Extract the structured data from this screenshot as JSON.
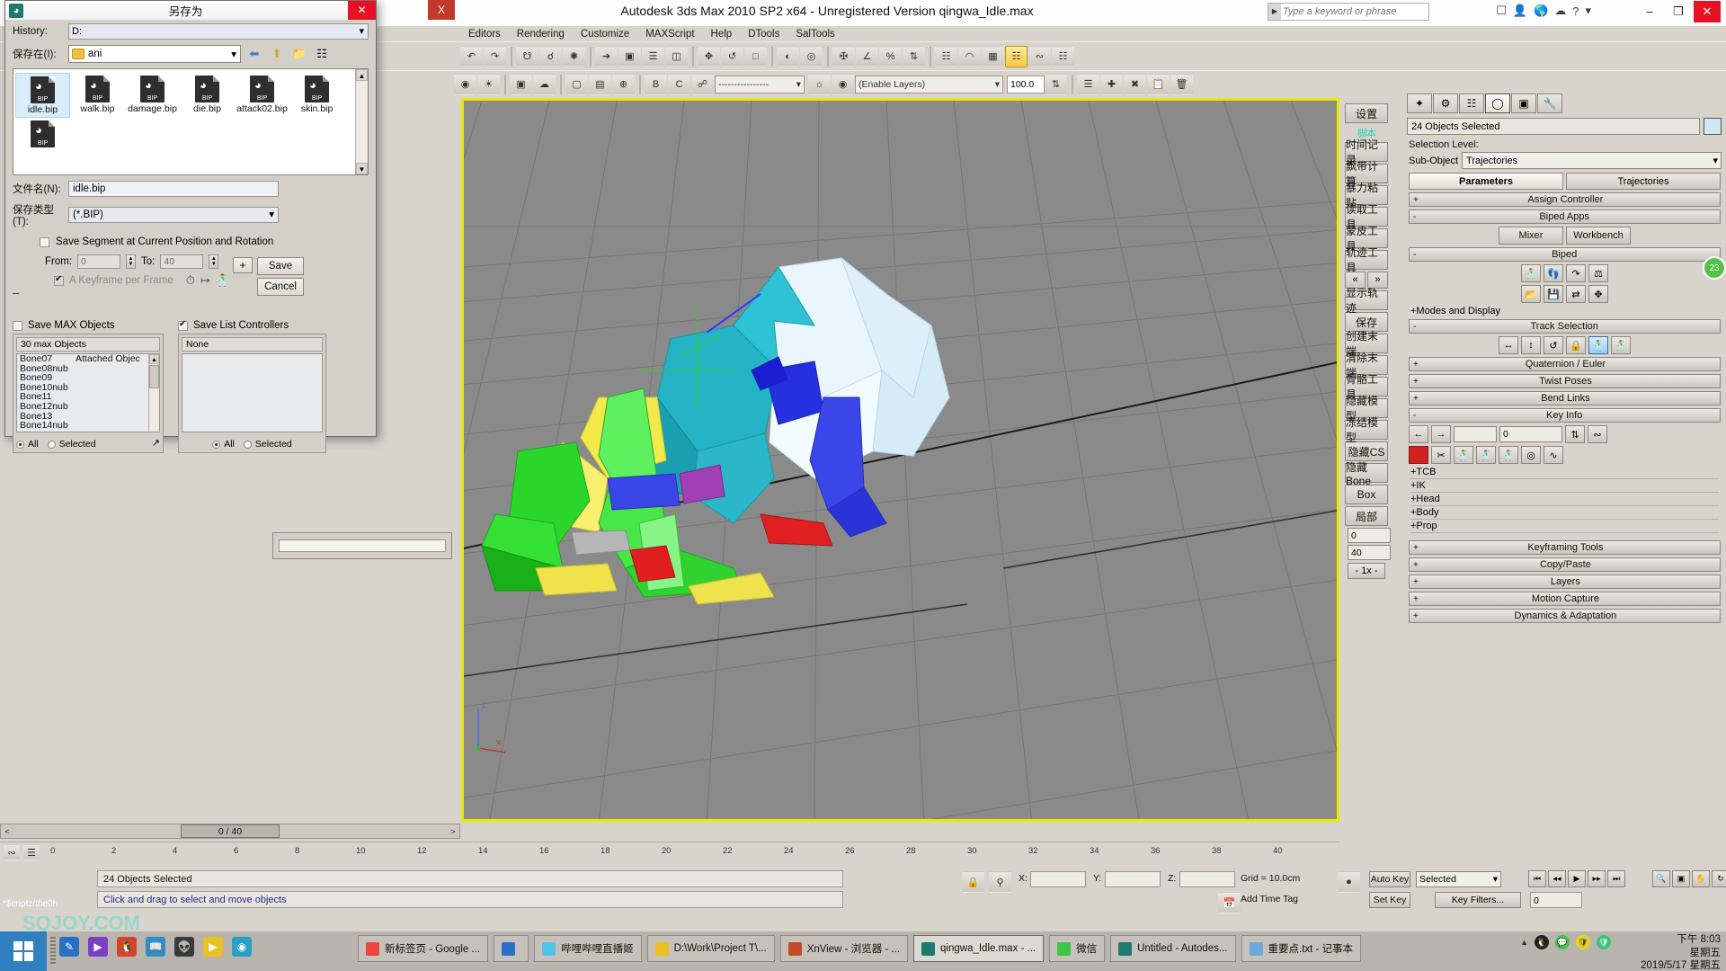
{
  "app": {
    "title": "Autodesk 3ds Max  2010 SP2 x64  - Unregistered Version     qingwa_Idle.max",
    "icon": "max-logo-icon",
    "search_placeholder": "Type a keyword or phrase",
    "min_label": "–",
    "max_label": "❐",
    "close_label": "✕",
    "x_badge": "X"
  },
  "menu": {
    "items": [
      "Editors",
      "Rendering",
      "Customize",
      "MAXScript",
      "Help",
      "DTools",
      "SalTools"
    ]
  },
  "toolbar2": {
    "layer_combo": "(Enable Layers)",
    "percent": "100.0"
  },
  "viewport": {
    "label": "",
    "axis_x": "X",
    "axis_y": "Y",
    "axis_z": "Z"
  },
  "trackbar": {
    "prev": "<",
    "frame": "0 / 40",
    "next": ">",
    "ruler_ticks": [
      "0",
      "2",
      "4",
      "6",
      "8",
      "10",
      "12",
      "14",
      "16",
      "18",
      "20",
      "22",
      "24",
      "26",
      "28",
      "30",
      "32",
      "34",
      "36",
      "38",
      "40"
    ]
  },
  "status": {
    "selection": "24 Objects Selected",
    "hint": "Click and drag to select and move objects",
    "x_label": "X:",
    "x_value": "",
    "y_label": "Y:",
    "y_value": "",
    "z_label": "Z:",
    "z_value": "",
    "grid": "Grid = 10.0cm",
    "add_time_tag": "Add Time Tag",
    "auto_key": "Auto Key",
    "set_key": "Set Key",
    "anim_combo": "Selected",
    "key_filters": "Key Filters...",
    "key_value": "0"
  },
  "zh_toolbar": {
    "settings": "设置",
    "title": "脚本",
    "buttons": [
      "时间记录",
      "飘带计算",
      "暴力粘贴",
      "读取工具",
      "蒙皮工具",
      "轨迹工具"
    ],
    "prev": "«",
    "next": "»",
    "buttons2": [
      "显示轨迹",
      "保存",
      "创建末端",
      "清除末端",
      "骨骼工具",
      "隐藏模型",
      "冻结模型",
      "隐藏CS",
      "隐藏Bone"
    ],
    "box": "Box",
    "local": "局部",
    "from": "0",
    "to": "40",
    "x1": "- 1x -"
  },
  "command_panel": {
    "tabs": [
      "create-icon",
      "modify-icon",
      "hierarchy-icon",
      "motion-icon",
      "display-icon",
      "utilities-icon"
    ],
    "object_name": "24 Objects Selected",
    "selection_level_label": "Selection Level:",
    "sub_object_label": "Sub-Object",
    "sub_object_value": "Trajectories",
    "tab_parameters": "Parameters",
    "tab_trajectories": "Trajectories",
    "rollouts": [
      {
        "sign": "+",
        "text": "Assign Controller"
      },
      {
        "sign": "-",
        "text": "Biped Apps"
      },
      {
        "sign": "-",
        "text": "Biped"
      },
      {
        "sign": "-",
        "text": "Track Selection"
      },
      {
        "sign": "+",
        "text": "Quaternion / Euler"
      },
      {
        "sign": "+",
        "text": "Twist Poses"
      },
      {
        "sign": "+",
        "text": "Bend Links"
      },
      {
        "sign": "-",
        "text": "Key Info"
      },
      {
        "sign": "+",
        "text": "Keyframing Tools"
      },
      {
        "sign": "+",
        "text": "Copy/Paste"
      },
      {
        "sign": "+",
        "text": "Layers"
      },
      {
        "sign": "+",
        "text": "Motion Capture"
      },
      {
        "sign": "+",
        "text": "Dynamics & Adaptation"
      }
    ],
    "biped_apps": {
      "mixer": "Mixer",
      "workbench": "Workbench"
    },
    "modes_and_display": "+Modes and Display",
    "key_info_subs": [
      "+TCB",
      "+IK",
      "+Head",
      "+Body",
      "+Prop"
    ],
    "key_info_value": "0",
    "range_from": "0",
    "range_to": "40"
  },
  "dialog": {
    "title": "另存为",
    "close": "✕",
    "history_label": "History:",
    "history_value": "D:",
    "lookin_label": "保存在(I):",
    "lookin_value": "ani",
    "nav_icons": [
      "back-icon",
      "up-folder-icon",
      "new-folder-icon",
      "view-mode-icon"
    ],
    "files": [
      {
        "name": "idle.bip",
        "tag": "BIP",
        "selected": true
      },
      {
        "name": "walk.bip",
        "tag": "BIP",
        "selected": false
      },
      {
        "name": "damage.bip",
        "tag": "BIP",
        "selected": false
      },
      {
        "name": "die.bip",
        "tag": "BIP",
        "selected": false
      },
      {
        "name": "attack02.bip",
        "tag": "BIP",
        "selected": false
      },
      {
        "name": "skin.bip",
        "tag": "BIP",
        "selected": false
      },
      {
        "name": "",
        "tag": "BIP",
        "selected": false
      }
    ],
    "filename_label": "文件名(N):",
    "filename_value": "idle.bip",
    "filetype_label": "保存类型(T):",
    "filetype_value": "(*.BIP)",
    "save_segment_label": "Save Segment at Current Position and Rotation",
    "save_segment_checked": false,
    "from_label": "From:",
    "from_value": "0",
    "to_label": "To:",
    "to_value": "40",
    "keyframe_label": "A Keyframe per Frame",
    "keyframe_checked": true,
    "plus_button": "+",
    "save_button": "Save",
    "cancel_button": "Cancel",
    "save_max_objects_label": "Save MAX Objects",
    "save_max_objects_checked": false,
    "save_list_controllers_label": "Save List Controllers",
    "save_list_controllers_checked": true,
    "left_list_header": "30 max Objects",
    "left_list_col2": "Attached Objec",
    "left_list_items": [
      "Bone07",
      "Bone08nub",
      "Bone09",
      "Bone10nub",
      "Bone11",
      "Bone12nub",
      "Bone13",
      "Bone14nub"
    ],
    "right_list_header": "None",
    "right_list_items": [],
    "radio_all": "All",
    "radio_selected": "Selected",
    "left_radio_selected": "All",
    "right_radio_selected": "All"
  },
  "taskbar": {
    "start": "start-windows-icon",
    "quick_icons": [
      "notepad-icon",
      "media-icon",
      "qq-icon",
      "dict-icon",
      "alien-icon",
      "player-icon",
      "browser-icon"
    ],
    "tasks": [
      {
        "label": "新标签页 - Google ...",
        "icon": "chrome-icon",
        "active": false
      },
      {
        "label": "",
        "icon": "blue-app-icon",
        "active": false
      },
      {
        "label": "哔哩哔哩直播姬",
        "icon": "bilibili-icon",
        "active": false
      },
      {
        "label": "D:\\Work\\Project T\\...",
        "icon": "folder-icon",
        "active": false
      },
      {
        "label": "XnView - 浏览器 - ...",
        "icon": "xnview-icon",
        "active": false
      },
      {
        "label": "qingwa_Idle.max - ...",
        "icon": "max-icon",
        "active": true
      },
      {
        "label": "微信",
        "icon": "wechat-icon",
        "active": false
      },
      {
        "label": "Untitled - Autodes...",
        "icon": "max-icon",
        "active": false
      },
      {
        "label": "重要点.txt - 记事本",
        "icon": "notepad-icon",
        "active": false
      }
    ],
    "tray_icons": [
      "arrow-up-icon",
      "qq-penguin-icon",
      "wechat-green-icon",
      "shield-green-icon",
      "shield-guard-icon"
    ],
    "clock": {
      "time": "下午 8:03",
      "weekday": "星期五",
      "date": "2019/5/17 星期五"
    }
  },
  "watermark": {
    "script_text": "*$criptz/the0h",
    "site": "SQJOY.COM"
  }
}
